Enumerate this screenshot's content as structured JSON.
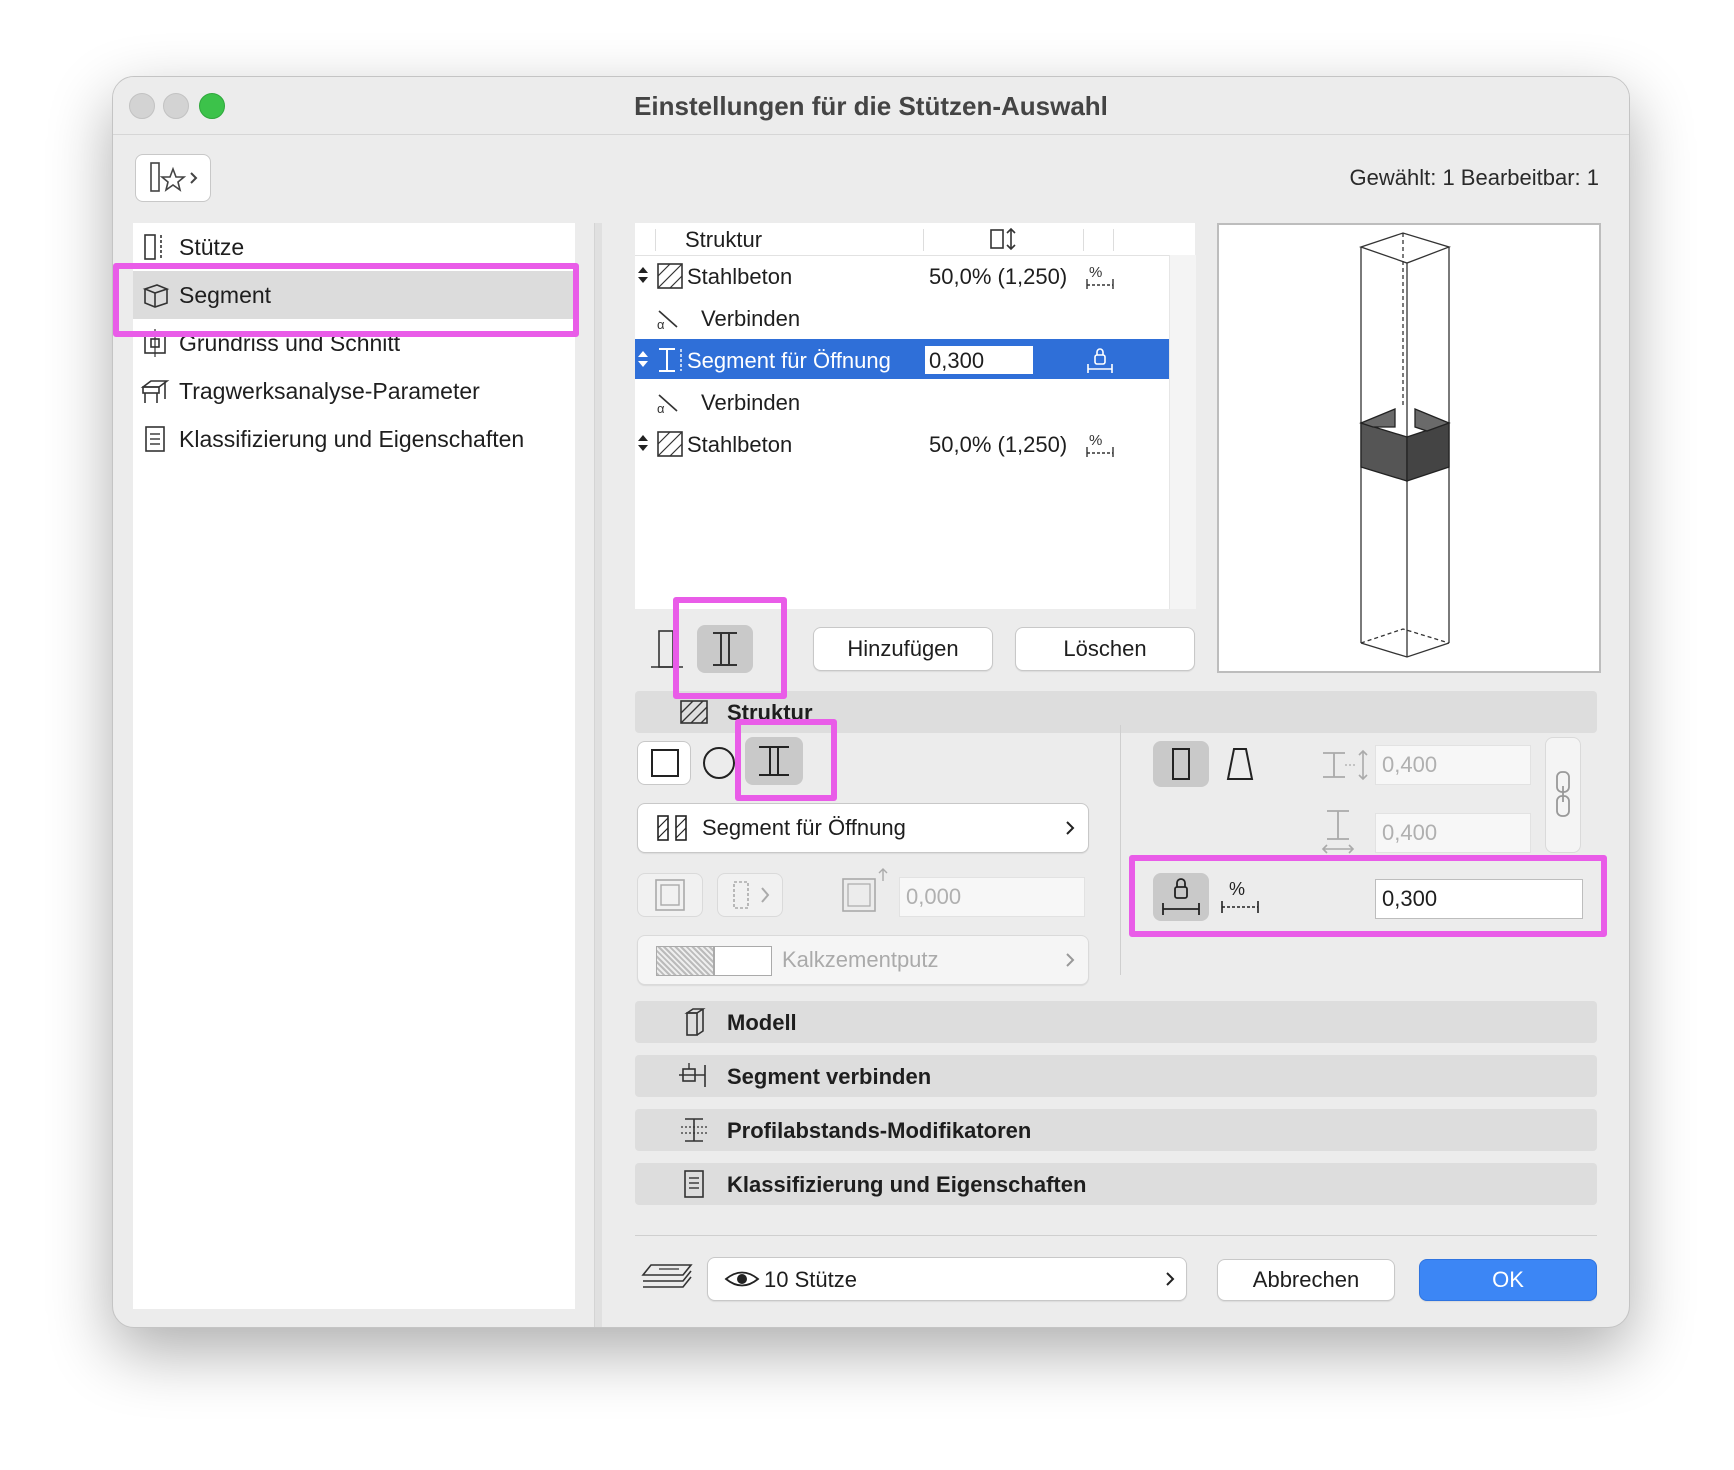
{
  "window": {
    "title": "Einstellungen für die Stützen-Auswahl"
  },
  "header": {
    "selection_info": "Gewählt: 1 Bearbeitbar: 1"
  },
  "sidebar": {
    "items": [
      {
        "label": "Stütze",
        "icon": "column-icon"
      },
      {
        "label": "Segment",
        "icon": "segment-icon",
        "selected": true
      },
      {
        "label": "Grundriss und Schnitt",
        "icon": "floorplan-icon"
      },
      {
        "label": "Tragwerksanalyse-Parameter",
        "icon": "structural-analysis-icon"
      },
      {
        "label": "Klassifizierung und Eigenschaften",
        "icon": "classification-icon"
      }
    ]
  },
  "segment_table": {
    "header": {
      "col1": "Struktur"
    },
    "rows": [
      {
        "name": "Stahlbeton",
        "value": "50,0% (1,250)",
        "type": "segment"
      },
      {
        "name": "Verbinden",
        "type": "joint"
      },
      {
        "name": "Segment für Öffnung",
        "value": "0,300",
        "type": "segment",
        "selected": true
      },
      {
        "name": "Verbinden",
        "type": "joint"
      },
      {
        "name": "Stahlbeton",
        "value": "50,0% (1,250)",
        "type": "segment"
      }
    ],
    "add_button": "Hinzufügen",
    "delete_button": "Löschen"
  },
  "sections": {
    "struktur": "Struktur",
    "modell": "Modell",
    "segment_verbinden": "Segment verbinden",
    "profilabstand": "Profilabstands-Modifikatoren",
    "klassifizierung": "Klassifizierung und Eigenschaften"
  },
  "struktur": {
    "profile_select": "Segment für Öffnung",
    "offset_value": "0,000",
    "surface_material": "Kalkzementputz",
    "width_value": "0,400",
    "depth_value": "0,400",
    "length_value": "0,300"
  },
  "footer": {
    "layer_select": "10 Stütze",
    "cancel_button": "Abbrechen",
    "ok_button": "OK"
  },
  "colors": {
    "accent": "#2f6fd8",
    "ok": "#3c86f5",
    "highlight": "#e95ce8",
    "close": "#d0d0d0",
    "zoom": "#3cc24a"
  }
}
